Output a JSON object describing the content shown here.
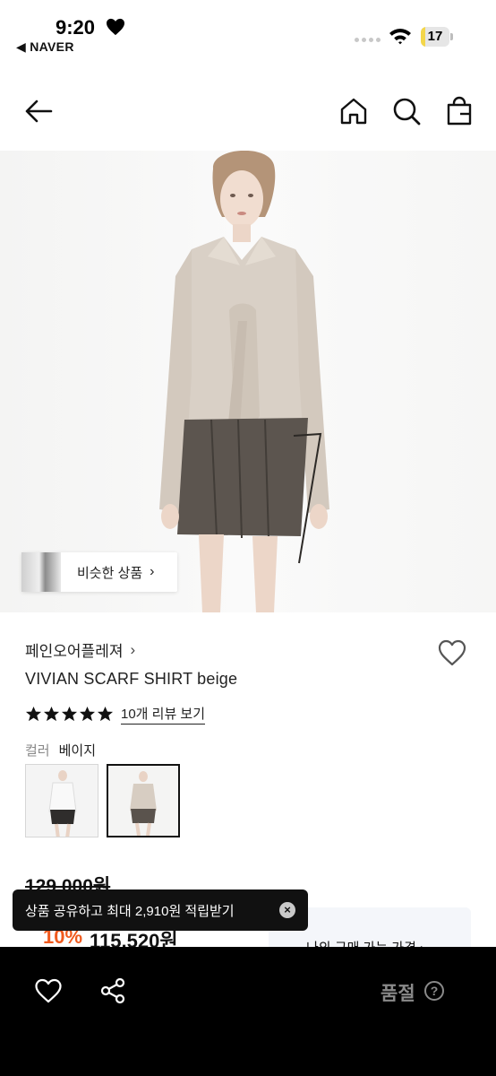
{
  "status_bar": {
    "time": "9:20",
    "back_app": "◀ NAVER",
    "battery_level": "17",
    "battery_fraction": 0.17
  },
  "nav": {
    "back_icon": "arrow-left-icon",
    "home_icon": "home-icon",
    "search_icon": "search-icon",
    "bag_icon": "shopping-bag-icon"
  },
  "hero": {
    "similar_label": "비슷한 상품",
    "similar_chevron": "›"
  },
  "product": {
    "brand": "페인오어플레져",
    "brand_chevron": "›",
    "name": "VIVIAN SCARF SHIRT beige",
    "rating_stars": 5,
    "review_link": "10개 리뷰 보기",
    "color_label": "컬러",
    "color_value": "베이지"
  },
  "price": {
    "original": "129,000원",
    "discount": "10%",
    "sale": "115,520원",
    "box_text": "나의 구매 가능 가격 ›"
  },
  "toast": {
    "message": "상품 공유하고 최대 2,910원 적립받기",
    "close": "×"
  },
  "bottom_bar": {
    "soldout_label": "품절",
    "help": "?"
  },
  "colors": {
    "accent_discount": "#f05a1e",
    "bottom_bar": "#000000",
    "star": "#111111"
  }
}
